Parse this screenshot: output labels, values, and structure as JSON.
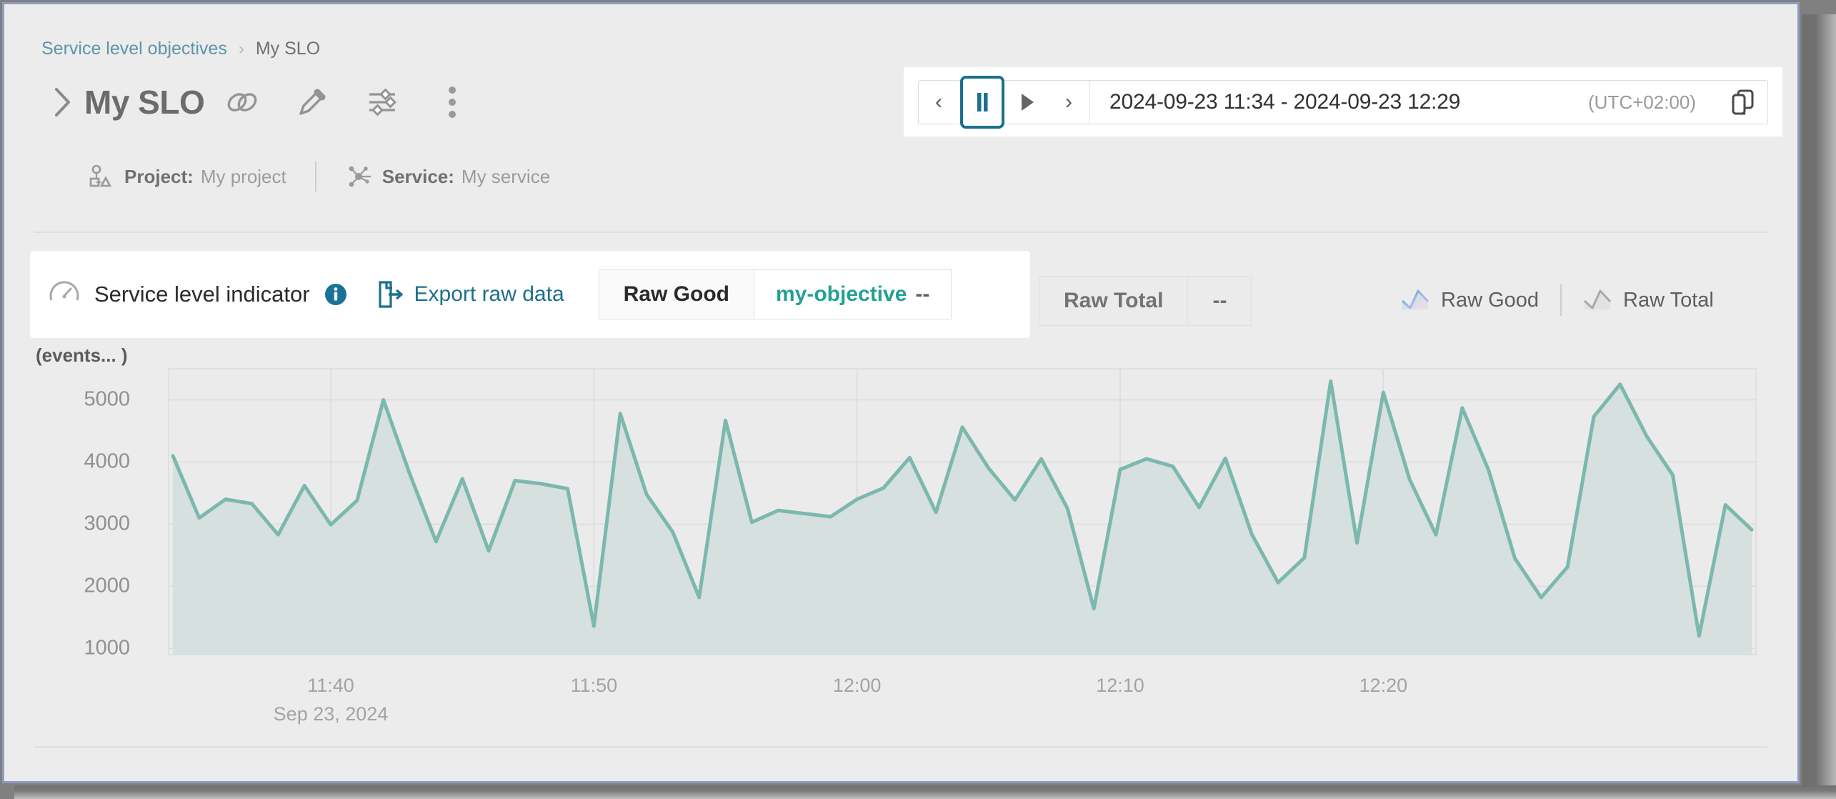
{
  "breadcrumb": {
    "root": "Service level objectives",
    "separator": "›",
    "current": "My SLO"
  },
  "header": {
    "expand_icon": "chevron-right-icon",
    "title": "My SLO",
    "actions": [
      {
        "name": "link-icon",
        "label": "Copy link"
      },
      {
        "name": "pencil-icon",
        "label": "Edit"
      },
      {
        "name": "sliders-icon",
        "label": "Settings"
      },
      {
        "name": "kebab-menu-icon",
        "label": "More actions"
      }
    ]
  },
  "meta": {
    "project_label": "Project:",
    "project_value": "My project",
    "service_label": "Service:",
    "service_value": "My service"
  },
  "timebar": {
    "prev_label": "‹",
    "pause_label": "pause",
    "play_label": "play",
    "next_label": "›",
    "range": "2024-09-23 11:34 - 2024-09-23 12:29",
    "timezone": "(UTC+02:00)",
    "copy_label": "copy-timeframe"
  },
  "sli": {
    "title": "Service level indicator",
    "info_label": "i",
    "export_label": "Export raw data",
    "segment_primary": {
      "left": "Raw Good",
      "objective": "my-objective",
      "value": "--"
    },
    "segment_secondary": {
      "left": "Raw Total",
      "value": "--"
    }
  },
  "legend": [
    {
      "label": "Raw Good",
      "icon": "area-chart-icon-color"
    },
    {
      "label": "Raw Total",
      "icon": "area-chart-icon-gray"
    }
  ],
  "colors": {
    "accent_teal": "#23a195",
    "line_teal": "#7bb8ad",
    "area_teal": "#d6e0de",
    "link_blue": "#1d6f8e",
    "breadcrumb_blue": "#5e94a8",
    "page_bg": "#ececec",
    "frame_border": "#8f9bc4"
  },
  "chart_data": {
    "type": "area",
    "title": "",
    "ylabel": "(events... )",
    "xlabel": "",
    "series_name": "Raw Good",
    "xlim_labels": [
      "11:40",
      "11:50",
      "12:00",
      "12:10",
      "12:20"
    ],
    "date_label": "Sep 23, 2024",
    "yticks": [
      1000,
      2000,
      3000,
      4000,
      5000
    ],
    "ylim": [
      900,
      5500
    ],
    "grid": true,
    "legend_position": "top-right",
    "x_start": "11:34",
    "x_end": "12:29",
    "interval_minutes": 1,
    "values": [
      4100,
      3100,
      3400,
      3330,
      2830,
      3620,
      2990,
      3380,
      5000,
      3810,
      2720,
      3730,
      2570,
      3700,
      3650,
      3570,
      1360,
      4780,
      3480,
      2870,
      1820,
      4670,
      3030,
      3220,
      3170,
      3120,
      3400,
      3580,
      4070,
      3190,
      4560,
      3900,
      3390,
      4050,
      3250,
      1640,
      3880,
      4050,
      3930,
      3270,
      4060,
      2840,
      2060,
      2460,
      5300,
      2700,
      5120,
      3720,
      2830,
      4870,
      3870,
      2450,
      1820,
      2310,
      4730,
      5250,
      4420,
      3790,
      1200,
      3310,
      2910
    ]
  }
}
